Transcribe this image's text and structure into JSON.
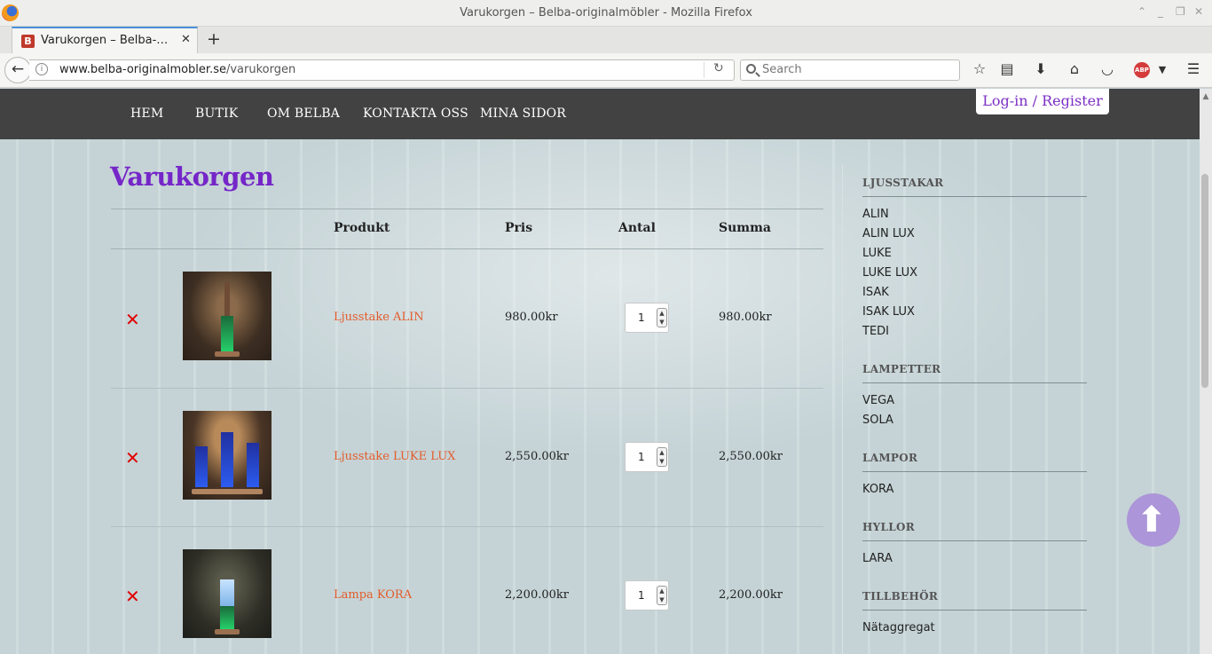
{
  "browser": {
    "window_title": "Varukorgen – Belba-originalmöbler - Mozilla Firefox",
    "tab_title": "Varukorgen – Belba-…",
    "tab_favicon": "B",
    "url_domain": "www.belba-originalmobler.se",
    "url_path": "/varukorgen",
    "search_placeholder": "Search",
    "abp_label": "ABP"
  },
  "site": {
    "nav": [
      "HEM",
      "BUTIK",
      "OM BELBA",
      "KONTAKTA OSS",
      "MINA SIDOR"
    ],
    "login_label": "Log-in / Register"
  },
  "cart": {
    "title": "Varukorgen",
    "columns": {
      "product": "Produkt",
      "price": "Pris",
      "qty": "Antal",
      "sum": "Summa"
    },
    "remove_glyph": "✕",
    "items": [
      {
        "name": "Ljusstake ALIN",
        "price": "980.00kr",
        "qty": "1",
        "sum": "980.00kr"
      },
      {
        "name": "Ljusstake LUKE LUX",
        "price": "2,550.00kr",
        "qty": "1",
        "sum": "2,550.00kr"
      },
      {
        "name": "Lampa KORA",
        "price": "2,200.00kr",
        "qty": "1",
        "sum": "2,200.00kr"
      }
    ]
  },
  "sidebar": {
    "categories": [
      {
        "heading": "LJUSSTAKAR",
        "items": [
          "ALIN",
          "ALIN LUX",
          "LUKE",
          "LUKE LUX",
          "ISAK",
          "ISAK LUX",
          "TEDI"
        ]
      },
      {
        "heading": "LAMPETTER",
        "items": [
          "VEGA",
          "SOLA"
        ]
      },
      {
        "heading": "LAMPOR",
        "items": [
          "KORA"
        ]
      },
      {
        "heading": "HYLLOR",
        "items": [
          "LARA"
        ]
      },
      {
        "heading": "TILLBEHÖR",
        "items": [
          "Nätaggregat"
        ]
      }
    ]
  },
  "icons": {
    "back": "back-arrow-icon",
    "bookmark": "star-icon",
    "reader": "reading-list-icon",
    "download": "download-icon",
    "home": "home-icon",
    "pocket": "pocket-icon",
    "menu": "hamburger-menu-icon",
    "scroll_top": "arrow-up-icon"
  },
  "colors": {
    "title_purple": "#7526c8",
    "product_link": "#e35b2a",
    "remove_red": "#e00000",
    "nav_bg": "#424242"
  }
}
